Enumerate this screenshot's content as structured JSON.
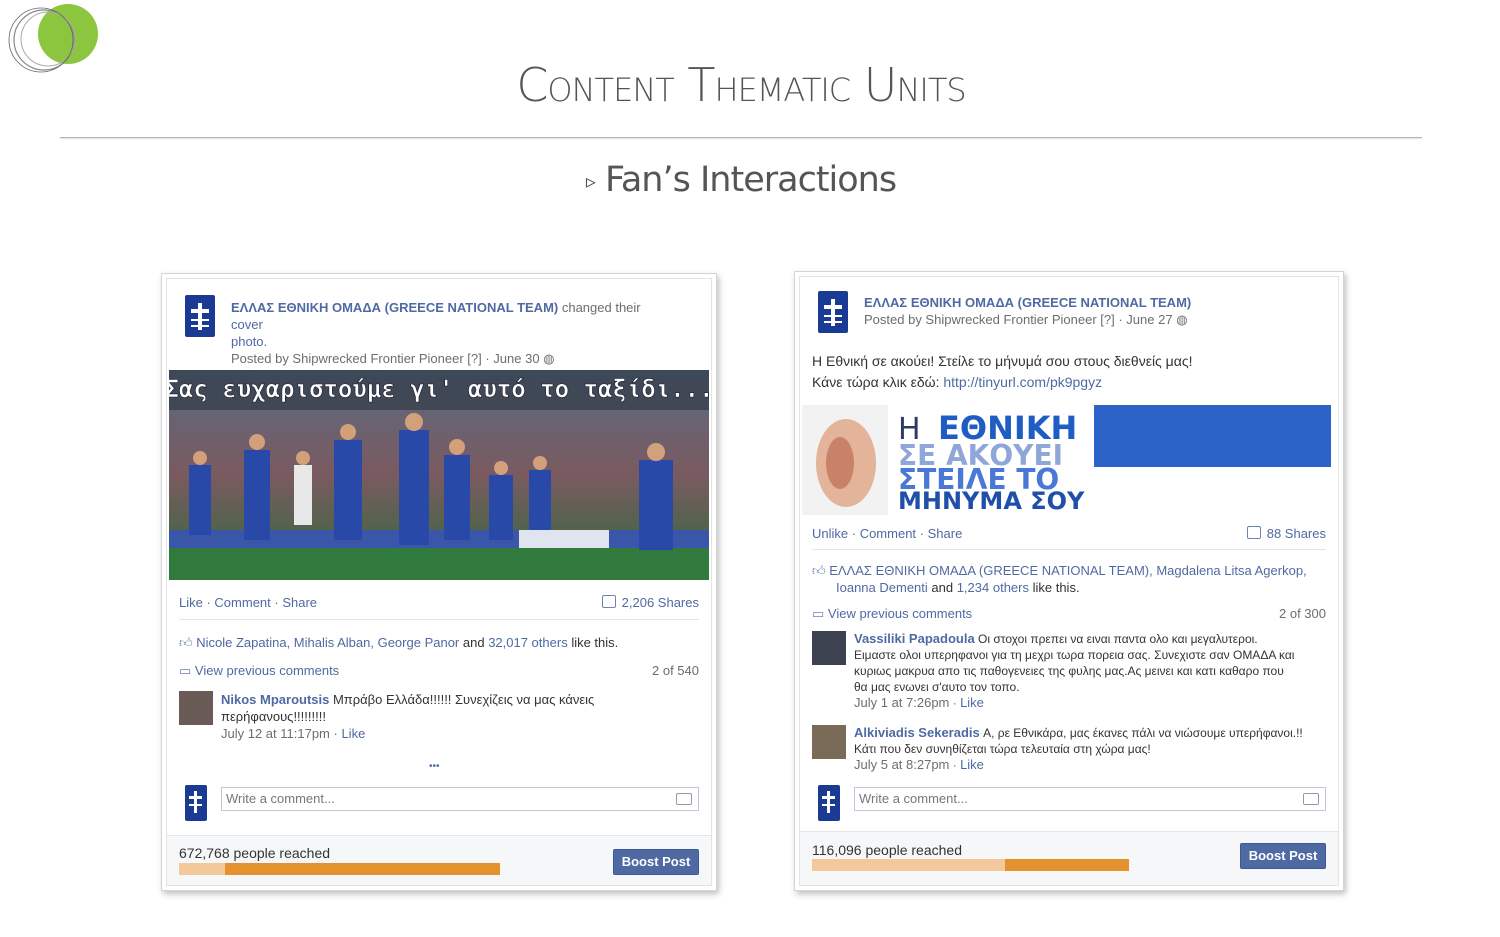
{
  "slide": {
    "title": "Content Thematic Units",
    "subtitle": "Fan’s Interactions",
    "bullet_glyph": "▹"
  },
  "post1": {
    "page_name": "ΕΛΛΑΣ ΕΘΝΙΚΗ ΟΜΑΔΑ (GREECE NATIONAL TEAM)",
    "action": " changed their ",
    "action_link": "cover",
    "action_line2": "photo.",
    "posted_by": "Posted by Shipwrecked Frontier Pioneer [?] · June 30",
    "image_caption": "Σας ευχαριστούμε γι' αυτό το ταξίδι...",
    "actions": [
      "Like",
      "Comment",
      "Share"
    ],
    "shares": "2,206 Shares",
    "likes_names": "Nicole Zapatina, Mihalis Alban, George Panor",
    "likes_and": " and ",
    "likes_others": "32,017 others",
    "likes_suffix": " like this.",
    "view_previous": "View previous comments",
    "count": "2 of 540",
    "comment": {
      "author": "Nikos Mparoutsis",
      "text": " Μπράβο Ελλάδα!!!!!! Συνεχίζεις να μας κάνεις",
      "text2": "περήφανους!!!!!!!!!",
      "time": "July 12 at 11:17pm",
      "like": "Like"
    },
    "more": "•••",
    "write_placeholder": "Write a comment...",
    "reached": "672,768 people reached",
    "reach_fraction": 0.142,
    "boost": "Boost Post"
  },
  "post2": {
    "page_name": "ΕΛΛΑΣ ΕΘΝΙΚΗ ΟΜΑΔΑ (GREECE NATIONAL TEAM)",
    "posted_by": "Posted by Shipwrecked Frontier Pioneer [?] · June 27",
    "body1": "Η Εθνική σε ακούει! Στείλε το μήνυμά σου στους διεθνείς μας!",
    "body2_prefix": "Κάνε τώρα κλικ εδώ: ",
    "body2_link": "http://tinyurl.com/pk9pgyz",
    "banner": {
      "l1a": "Η ",
      "l1b": "ΕΘΝΙΚΗ",
      "l2": "ΣΕ ΑΚΟΥΕΙ",
      "l3": "ΣΤΕΙΛΕ ΤΟ",
      "l4": "ΜΗΝΥΜΑ ΣΟΥ"
    },
    "actions": [
      "Unlike",
      "Comment",
      "Share"
    ],
    "shares": "88 Shares",
    "likes_names": "ΕΛΛΑΣ ΕΘΝΙΚΗ ΟΜΑΔΑ (GREECE NATIONAL TEAM), Magdalena Litsa Agerkop,",
    "likes_names2": "Ioanna Dementi",
    "likes_and": " and ",
    "likes_others": "1,234 others",
    "likes_suffix": " like this.",
    "view_previous": "View previous comments",
    "count": "2 of 300",
    "comment1": {
      "author": "Vassiliki Papadoula",
      "l1": " Οι στοχοι πρεπει να ειναι παντα ολο και μεγαλυτεροι.",
      "l2": "Ειμαστε ολοι υπερηφανοι για τη μεχρι τωρα πορεια σας. Συνεχιστε σαν ΟΜΑΔΑ και",
      "l3": "κυριως μακρυα απο τις παθογενειες της φυλης μας.Ας μεινει και κατι καθαρο που",
      "l4": "θα μας ενωνει σ'αυτο τον τοπο.",
      "time": "July 1 at 7:26pm",
      "like": "Like"
    },
    "comment2": {
      "author": "Alkiviadis Sekeradis",
      "l1": " Α, ρε Εθνικάρα, μας έκανες πάλι να νιώσουμε υπερήφανοι.!!",
      "l2": "Κάτι που δεν συνηθίζεται τώρα τελευταία στη χώρα μας!",
      "time": "July 5 at 8:27pm",
      "like": "Like"
    },
    "write_placeholder": "Write a comment...",
    "reached": "116,096 people reached",
    "reach_fraction": 0.61,
    "boost": "Boost Post"
  },
  "colors": {
    "fb_link": "#4f6aa3",
    "team_blue": "#1a3a94",
    "accent_green": "#8cc63f",
    "reach_orange": "#e3922f"
  }
}
